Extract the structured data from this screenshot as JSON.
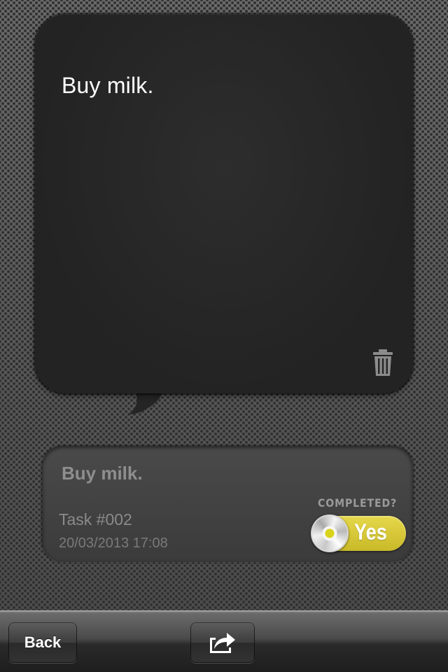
{
  "note": {
    "text": "Buy milk."
  },
  "card": {
    "title": "Buy milk.",
    "task_number": "Task #002",
    "date": "20/03/2013 17:08",
    "completed_label": "COMPLETED?",
    "completed_toggle": "Yes",
    "completed_state": true
  },
  "toolbar": {
    "back_label": "Back"
  },
  "icons": {
    "trash": "trash-icon",
    "share": "share-icon"
  },
  "colors": {
    "toggle_on": "#d9c83a",
    "bubble_bg": "#262626"
  }
}
